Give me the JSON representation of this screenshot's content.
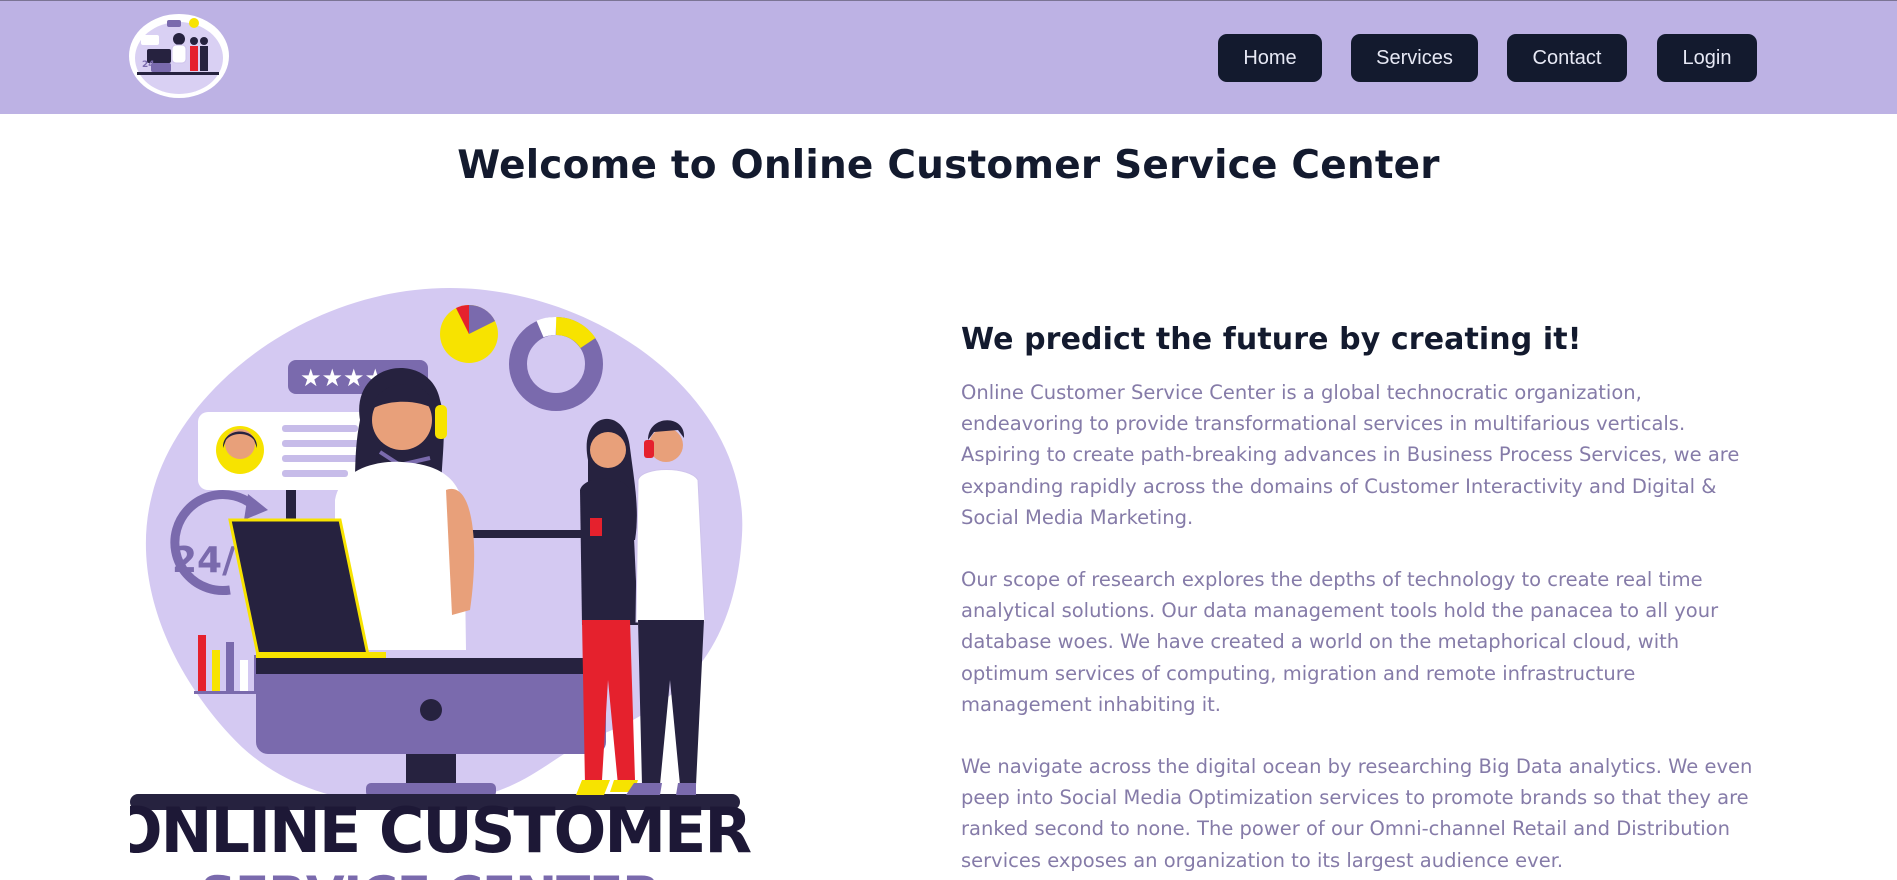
{
  "header": {
    "logo_icon": "customer-service-logo",
    "nav": [
      {
        "label": "Home"
      },
      {
        "label": "Services"
      },
      {
        "label": "Contact"
      },
      {
        "label": "Login"
      }
    ]
  },
  "main": {
    "title": "Welcome to Online Customer Service Center",
    "hero": {
      "badge_text": "24/7",
      "rating_stars": "★★★★★",
      "caption_line1": "ONLINE CUSTOMER",
      "caption_line2": "SERVICE CENTER"
    },
    "about": {
      "heading": "We predict the future by creating it!",
      "paragraphs": [
        "Online Customer Service Center is a global technocratic organization, endeavoring to provide transformational services in multifarious verticals. Aspiring to create path-breaking advances in Business Process Services, we are expanding rapidly across the domains of Customer Interactivity and Digital & Social Media Marketing.",
        "Our scope of research explores the depths of technology to create real time analytical solutions. Our data management tools hold the panacea to all your database woes. We have created a world on the metaphorical cloud, with optimum services of computing, migration and remote infrastructure management inhabiting it.",
        "We navigate across the digital ocean by researching Big Data analytics. We even peep into Social Media Optimization services to promote brands so that they are ranked second to none. The power of our Omni-channel Retail and Distribution services exposes an organization to its largest audience ever."
      ]
    }
  },
  "colors": {
    "header_bg": "#bdb2e4",
    "nav_bg": "#131a2e",
    "title": "#131a2e",
    "body_text": "#857ba8",
    "accent_purple": "#7a6aad",
    "accent_light": "#d0c6f0",
    "accent_yellow": "#f7e300",
    "accent_red": "#e5212d"
  }
}
